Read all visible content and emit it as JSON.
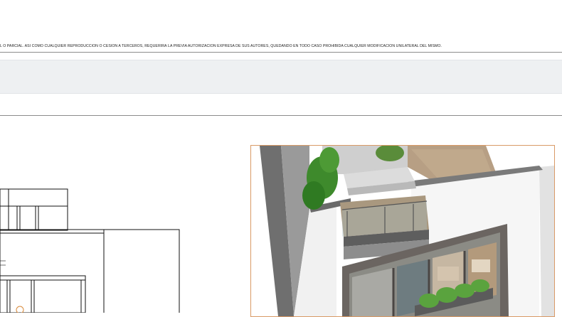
{
  "document": {
    "disclaimer": "L O PARCIAL.  ASÍ COMO CUALQUIER REPRODUCCIÓN O CESIÓN A TERCEROS, REQUERIRÁ LA PREVIA AUTORIZACIÓN EXPRESA DE  SUS  AUTORES, QUEDANDO  EN TODO CASO  PROHIBIDA  CUALQUIER MODIFICACIÓN UNILATERAL DEL MISMO."
  }
}
